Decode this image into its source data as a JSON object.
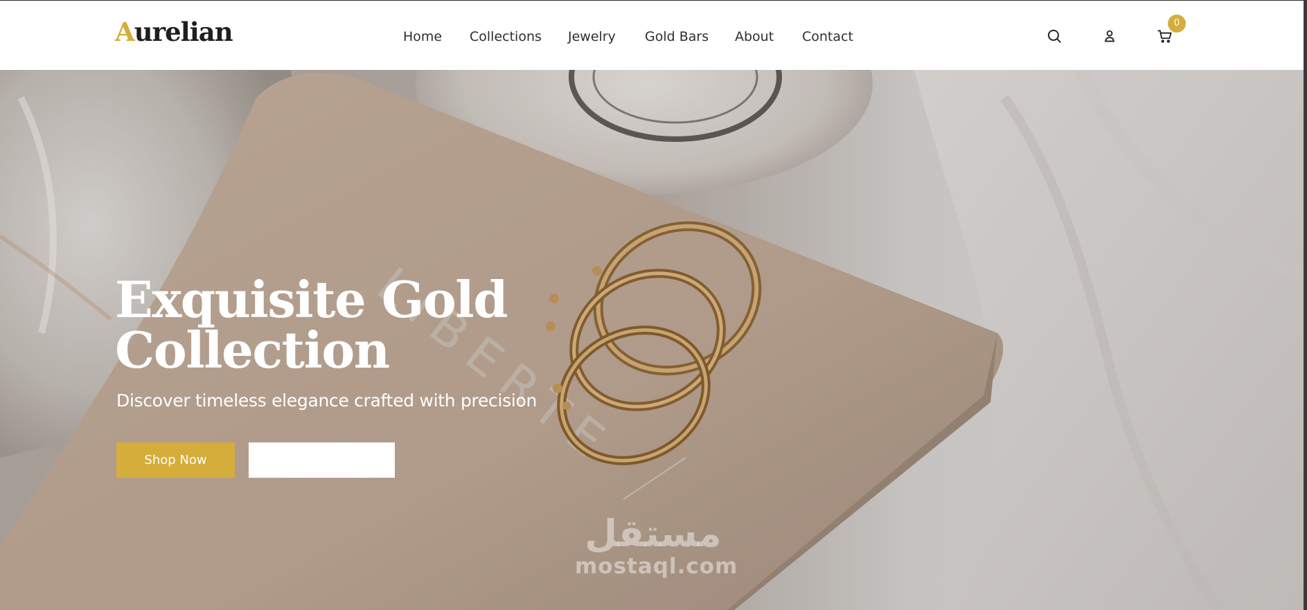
{
  "brand": {
    "logo_first": "A",
    "logo_rest": "urelian",
    "accent_color": "#d4ad3b"
  },
  "nav": {
    "items": [
      {
        "label": "Home"
      },
      {
        "label": "Collections"
      },
      {
        "label": "Jewelry"
      },
      {
        "label": "Gold Bars"
      },
      {
        "label": "About"
      },
      {
        "label": "Contact"
      }
    ]
  },
  "header_icons": {
    "search": "search-icon",
    "account": "user-icon",
    "cart": "cart-icon",
    "cart_count": "0"
  },
  "hero": {
    "title_line1": "Exquisite Gold",
    "title_line2": "Collection",
    "subtitle": "Discover timeless elegance crafted with precision",
    "primary_button": "Shop Now",
    "secondary_button": "",
    "background_image": "gold-rings-on-box-photo",
    "box_text": "LIBERTE"
  },
  "watermark": {
    "arabic": "مستقل",
    "latin": "mostaql.com"
  }
}
